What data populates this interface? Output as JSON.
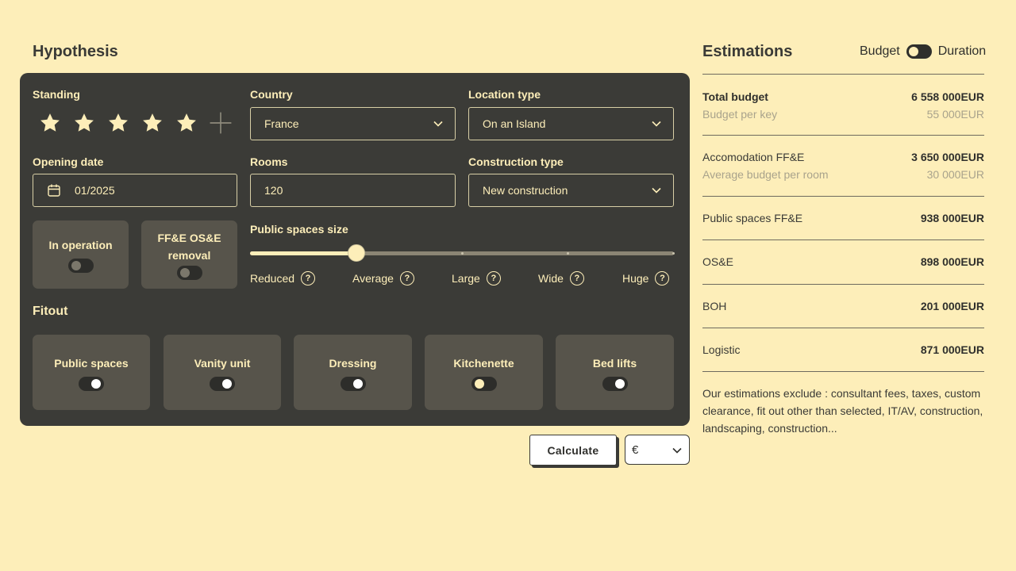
{
  "hypothesis": {
    "title": "Hypothesis",
    "standing": {
      "label": "Standing",
      "stars": 5
    },
    "country": {
      "label": "Country",
      "value": "France"
    },
    "location_type": {
      "label": "Location type",
      "value": "On an Island"
    },
    "opening_date": {
      "label": "Opening date",
      "value": "01/2025"
    },
    "rooms": {
      "label": "Rooms",
      "value": "120"
    },
    "construction_type": {
      "label": "Construction type",
      "value": "New construction"
    },
    "in_operation": {
      "label": "In operation",
      "on": false
    },
    "ffe_removal": {
      "label": "FF&E OS&E removal",
      "on": false
    },
    "public_spaces_size": {
      "label": "Public spaces size",
      "options": [
        "Reduced",
        "Average",
        "Large",
        "Wide",
        "Huge"
      ],
      "selected_index": 1
    },
    "fitout": {
      "label": "Fitout",
      "items": [
        {
          "label": "Public spaces",
          "on": true
        },
        {
          "label": "Vanity unit",
          "on": true
        },
        {
          "label": "Dressing",
          "on": true
        },
        {
          "label": "Kitchenette",
          "on": false
        },
        {
          "label": "Bed lifts",
          "on": true
        }
      ]
    }
  },
  "actions": {
    "calculate_label": "Calculate",
    "currency": "€"
  },
  "estimations": {
    "title": "Estimations",
    "switch_left": "Budget",
    "switch_right": "Duration",
    "rows": [
      {
        "name": "Total budget",
        "value": "6 558 000EUR",
        "sub": "Budget per key",
        "subval": "55 000EUR"
      },
      {
        "name": "Accomodation FF&E",
        "value": "3 650 000EUR",
        "sub": "Average budget per room",
        "subval": "30 000EUR"
      },
      {
        "name": "Public spaces FF&E",
        "value": "938 000EUR"
      },
      {
        "name": "OS&E",
        "value": "898 000EUR"
      },
      {
        "name": "BOH",
        "value": "201 000EUR"
      },
      {
        "name": "Logistic",
        "value": "871 000EUR"
      }
    ],
    "note": "Our estimations exclude : consultant fees, taxes, custom clearance, fit out other than selected, IT/AV, construction, landscaping, construction..."
  },
  "colors": {
    "background": "#fdeeb9",
    "panel": "#3b3b37",
    "tile": "#57544b",
    "accent": "#fdeeb9"
  },
  "icons": [
    "star-icon",
    "plus-icon",
    "calendar-icon",
    "chevron-down-icon",
    "question-icon"
  ]
}
